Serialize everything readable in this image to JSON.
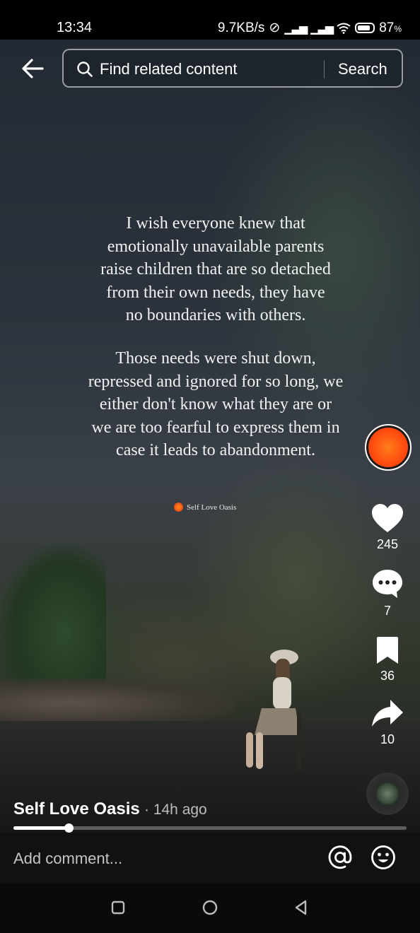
{
  "status_bar": {
    "time": "13:34",
    "network_speed": "9.7KB/s",
    "battery_percent": "87",
    "battery_unit": "%"
  },
  "top_bar": {
    "search_placeholder": "Find related content",
    "search_button": "Search"
  },
  "video": {
    "quote_paragraph_1": [
      "I wish everyone knew that",
      "emotionally unavailable parents",
      "raise children that are so detached",
      "from their own needs, they have",
      "no boundaries with others."
    ],
    "quote_paragraph_2": [
      "Those needs were shut down,",
      "repressed and ignored for so long, we",
      "either don't know what they are or",
      "we are too fearful to express them in",
      "case it leads to abandonment."
    ],
    "watermark": "Self Love Oasis",
    "progress_fraction": 0.14
  },
  "actions": {
    "likes": "245",
    "comments": "7",
    "saves": "36",
    "shares": "10"
  },
  "post": {
    "author": "Self Love Oasis",
    "time_ago": "· 14h ago"
  },
  "comment_bar": {
    "placeholder": "Add comment..."
  },
  "icons": {
    "back": "back-arrow-icon",
    "search": "search-icon",
    "like": "heart-icon",
    "comment": "comment-bubble-icon",
    "save": "bookmark-icon",
    "share": "share-arrow-icon",
    "mention": "at-sign-icon",
    "emoji": "emoji-icon",
    "nav_recents": "square-icon",
    "nav_home": "circle-icon",
    "nav_back": "triangle-back-icon"
  },
  "colors": {
    "avatar_accent": "#ff5a14",
    "background": "#000000"
  }
}
